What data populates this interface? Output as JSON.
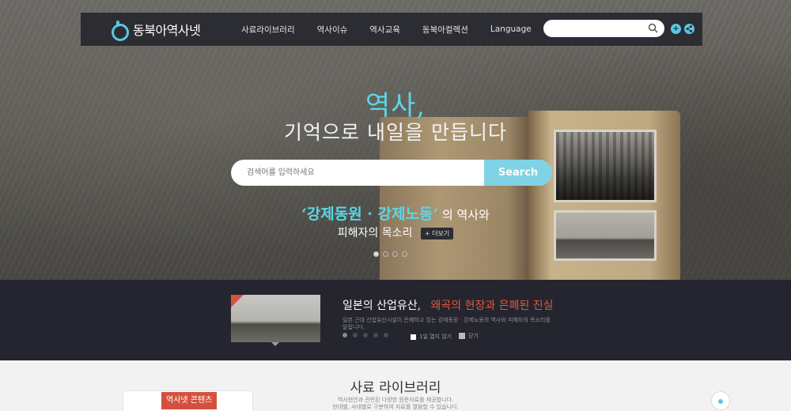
{
  "nav": {
    "logo_text": "동북아역사넷",
    "menu": [
      "사료라이브러리",
      "역사이슈",
      "역사교육",
      "동북아컬렉션",
      "Language"
    ],
    "search_placeholder": "",
    "plus_icon": "+",
    "share_icon": "share-icon"
  },
  "hero": {
    "kicker": "역사,",
    "title": "기억으로 내일을 만듭니다",
    "search_placeholder": "검색어를 입력하세요",
    "search_button": "Search",
    "promo_highlight": "‘강제동원 · 강제노동’",
    "promo_rest": "의 역사와",
    "promo_line2": "피해자의 목소리",
    "more_label": "+ 더보기",
    "slide_count": 4,
    "active_slide": 1
  },
  "band": {
    "title_main": "일본의 산업유산,",
    "title_highlight": "왜곡의 현장과 은폐된 진실",
    "description": "일본 근대 산업유산시설이 은폐하고 있는 강제동원 · 강제노동의 역사와 피해자의 목소리를 알립니다.",
    "dot_count": 5,
    "active_dot": 1,
    "checkbox_label": "1일 열지 않기",
    "close_label": "닫기"
  },
  "bottom": {
    "content_tab": "역사넷 콘텐츠",
    "library_title": "사료 라이브러리",
    "library_sub_line1": "역사현안과 관련된 다양한 원문자료를 제공합니다.",
    "library_sub_line2": "한대별, 사대별로 구분하여 자료를 열람할 수 있습니다."
  },
  "colors": {
    "accent": "#5bc7e0",
    "nav_bg": "#2c2d33",
    "band_bg": "#25252f",
    "highlight_red": "#e0583e"
  }
}
